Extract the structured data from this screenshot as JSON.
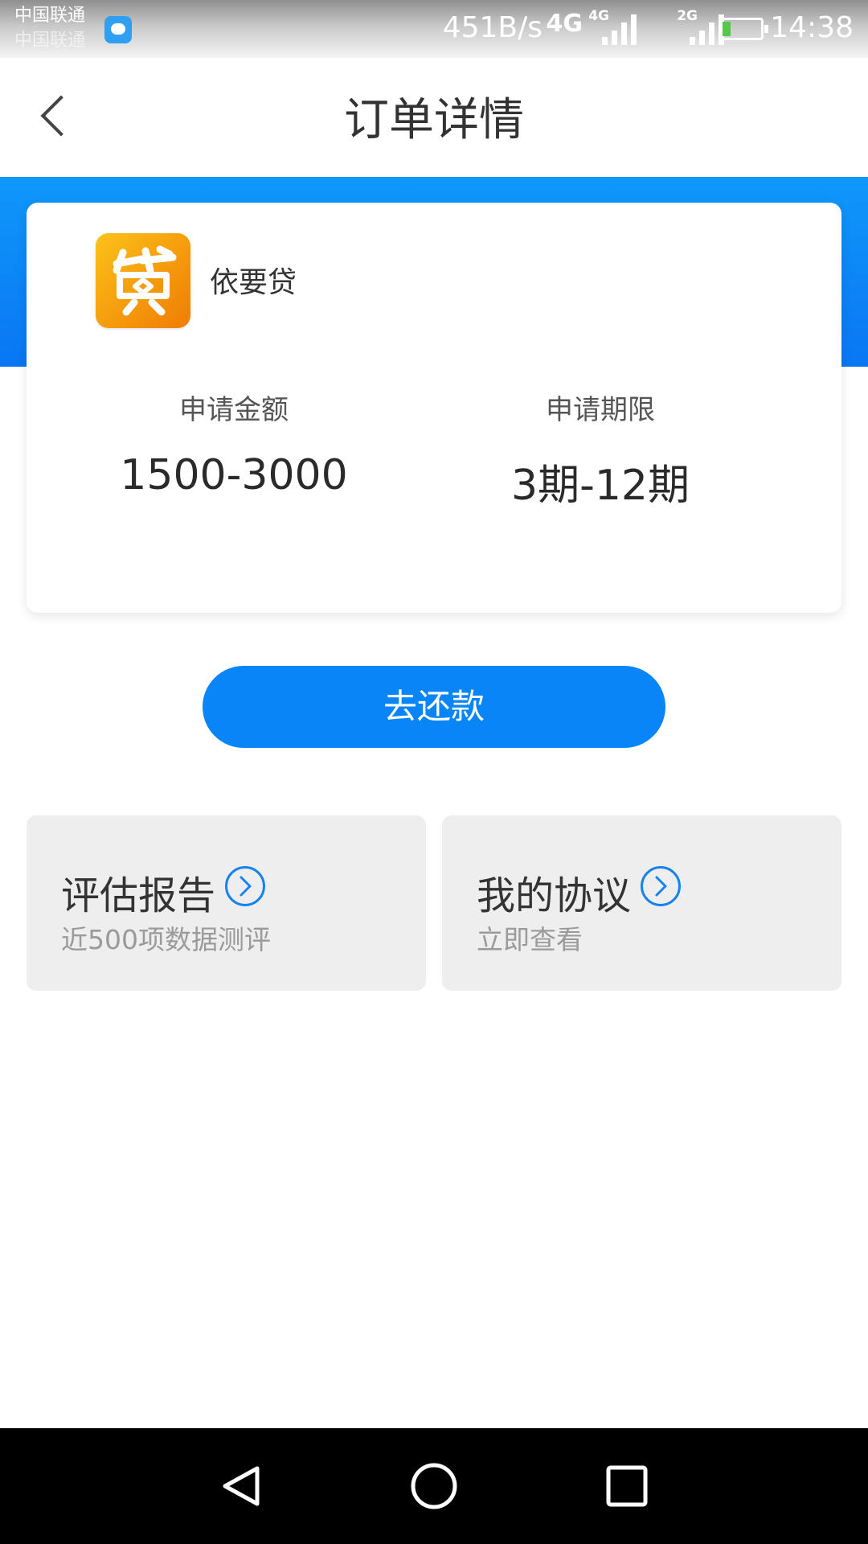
{
  "status_bar": {
    "carrier_primary": "中国联通",
    "carrier_secondary": "中国联通",
    "net_speed": "451B/s",
    "network_4g": "4G",
    "network_4g_small": "4G",
    "network_2g_small": "2G",
    "time": "14:38",
    "icons": [
      "message-icon",
      "signal-icon",
      "signal-icon",
      "battery-charging-icon"
    ]
  },
  "header": {
    "back_icon": "back-chevron-icon",
    "title": "订单详情"
  },
  "loan_card": {
    "app_name": "依要贷",
    "logo_icon": "daidai-logo-icon",
    "amount_label": "申请金额",
    "amount_value": "1500-3000",
    "term_label": "申请期限",
    "term_value": "3期-12期"
  },
  "actions": {
    "repay_label": "去还款"
  },
  "tiles": [
    {
      "title": "评估报告",
      "subtitle": "近500项数据测评",
      "icon": "chevron-right-circle-icon"
    },
    {
      "title": "我的协议",
      "subtitle": "立即查看",
      "icon": "chevron-right-circle-icon"
    }
  ],
  "nav_bar": {
    "icons": [
      "nav-back-icon",
      "nav-home-icon",
      "nav-recents-icon"
    ]
  },
  "colors": {
    "accent": "#0a85f7",
    "band_top": "#0f98fb",
    "tile_bg": "#eeeeee",
    "logo_orange": "#f59b0c"
  }
}
